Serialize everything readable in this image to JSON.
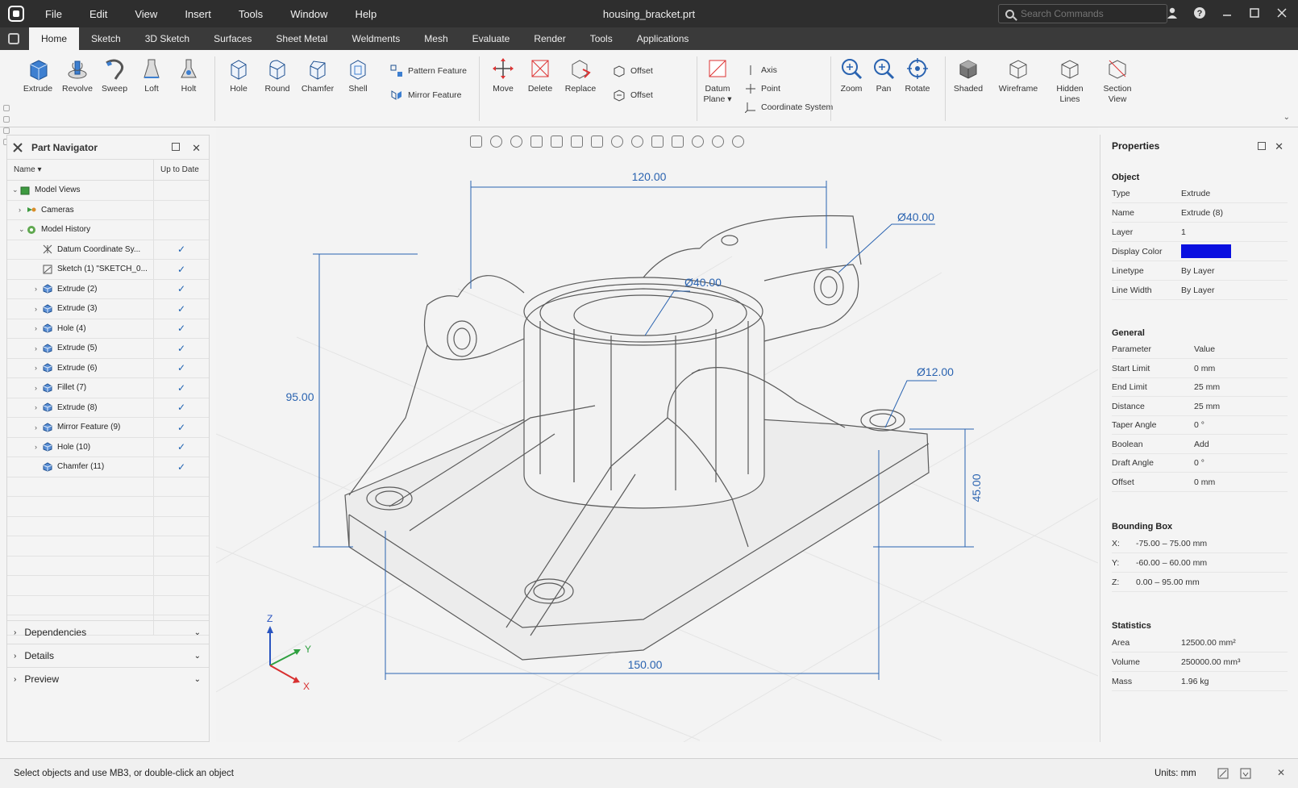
{
  "window": {
    "file_name": "housing_bracket.prt",
    "menu": [
      "File",
      "Edit",
      "View",
      "Insert",
      "Tools",
      "Window",
      "Help"
    ],
    "search_placeholder": "Search Commands"
  },
  "tabs": [
    "Home",
    "Sketch",
    "3D Sketch",
    "Surfaces",
    "Sheet Metal",
    "Weldments",
    "Mesh",
    "Evaluate",
    "Render",
    "Tools",
    "Applications"
  ],
  "active_tab": "Home",
  "ribbon": {
    "tools_a": [
      "Extrude",
      "Revolve",
      "Sweep",
      "Loft",
      "Holt"
    ],
    "tools_b": [
      "Hole",
      "Round",
      "Chamfer",
      "Shell"
    ],
    "pattern_feature": "Pattern Feature",
    "mirror_feature": "Mirror Feature",
    "tools_c": [
      "Move",
      "Delete",
      "Replace"
    ],
    "offset_1": "Offset",
    "offset_2": "Offset",
    "datum_plane_1": "Datum",
    "datum_plane_2": "Plane",
    "axis": "Axis",
    "point": "Point",
    "coordinate_system": "Coordinate System",
    "view_tools": [
      "Zoom",
      "Pan",
      "Rotate"
    ],
    "shaded": "Shaded",
    "wireframe": "Wireframe",
    "hidden_1": "Hidden",
    "hidden_2": "Lines",
    "section_1": "Section",
    "section_2": "View"
  },
  "navigator": {
    "title": "Part Navigator",
    "col_name": "Name",
    "col_status": "Up to Date",
    "rows": [
      {
        "label": "Model Views",
        "check": ""
      },
      {
        "label": "Cameras",
        "check": ""
      },
      {
        "label": "Model History",
        "check": ""
      },
      {
        "label": "Datum Coordinate Sy...",
        "check": "✓"
      },
      {
        "label": "Sketch (1) \"SKETCH_0...",
        "check": "✓"
      },
      {
        "label": "Extrude (2)",
        "check": "✓"
      },
      {
        "label": "Extrude (3)",
        "check": "✓"
      },
      {
        "label": "Hole (4)",
        "check": "✓"
      },
      {
        "label": "Extrude (5)",
        "check": "✓"
      },
      {
        "label": "Extrude (6)",
        "check": "✓"
      },
      {
        "label": "Fillet (7)",
        "check": "✓"
      },
      {
        "label": "Extrude (8)",
        "check": "✓"
      },
      {
        "label": "Mirror Feature (9)",
        "check": "✓"
      },
      {
        "label": "Hole (10)",
        "check": "✓"
      },
      {
        "label": "Chamfer (11)",
        "check": "✓"
      }
    ],
    "sections": [
      "Dependencies",
      "Details",
      "Preview"
    ]
  },
  "viewport": {
    "dims": {
      "width_top": "120.00",
      "dia_right": "Ø40.00",
      "dia_center": "Ø40.00",
      "height_left": "95.00",
      "dia_hole": "Ø12.00",
      "height_right": "45.00",
      "width_bottom": "150.00"
    },
    "axes": {
      "z": "Z",
      "y": "Y",
      "x": "X"
    }
  },
  "properties": {
    "title": "Properties",
    "object_title": "Object",
    "object": [
      {
        "k": "Type",
        "v": "Extrude"
      },
      {
        "k": "Name",
        "v": "Extrude (8)"
      },
      {
        "k": "Layer",
        "v": "1"
      },
      {
        "k": "Display Color",
        "v": ""
      },
      {
        "k": "Linetype",
        "v": "By Layer"
      },
      {
        "k": "Line Width",
        "v": "By Layer"
      }
    ],
    "display_color": "#0a10e0",
    "general_title": "General",
    "general": [
      {
        "k": "Parameter",
        "v": "Value"
      },
      {
        "k": "Start Limit",
        "v": "0 mm"
      },
      {
        "k": "End Limit",
        "v": "25 mm"
      },
      {
        "k": "Distance",
        "v": "25 mm"
      },
      {
        "k": "Taper Angle",
        "v": "0 °"
      },
      {
        "k": "Boolean",
        "v": "Add"
      },
      {
        "k": "Draft Angle",
        "v": "0 °"
      },
      {
        "k": "Offset",
        "v": "0 mm"
      }
    ],
    "bbox_title": "Bounding Box",
    "bbox": [
      {
        "k": "X:",
        "v": "-75.00  –  75.00 mm"
      },
      {
        "k": "Y:",
        "v": "-60.00  –  60.00 mm"
      },
      {
        "k": "Z:",
        "v": "0.00  –  95.00 mm"
      }
    ],
    "stats_title": "Statistics",
    "stats": [
      {
        "k": "Area",
        "v": "12500.00 mm²"
      },
      {
        "k": "Volume",
        "v": "250000.00 mm³"
      },
      {
        "k": "Mass",
        "v": "1.96 kg"
      }
    ]
  },
  "status": {
    "message": "Select objects and use MB3, or double-click an object",
    "units": "Units: mm"
  }
}
